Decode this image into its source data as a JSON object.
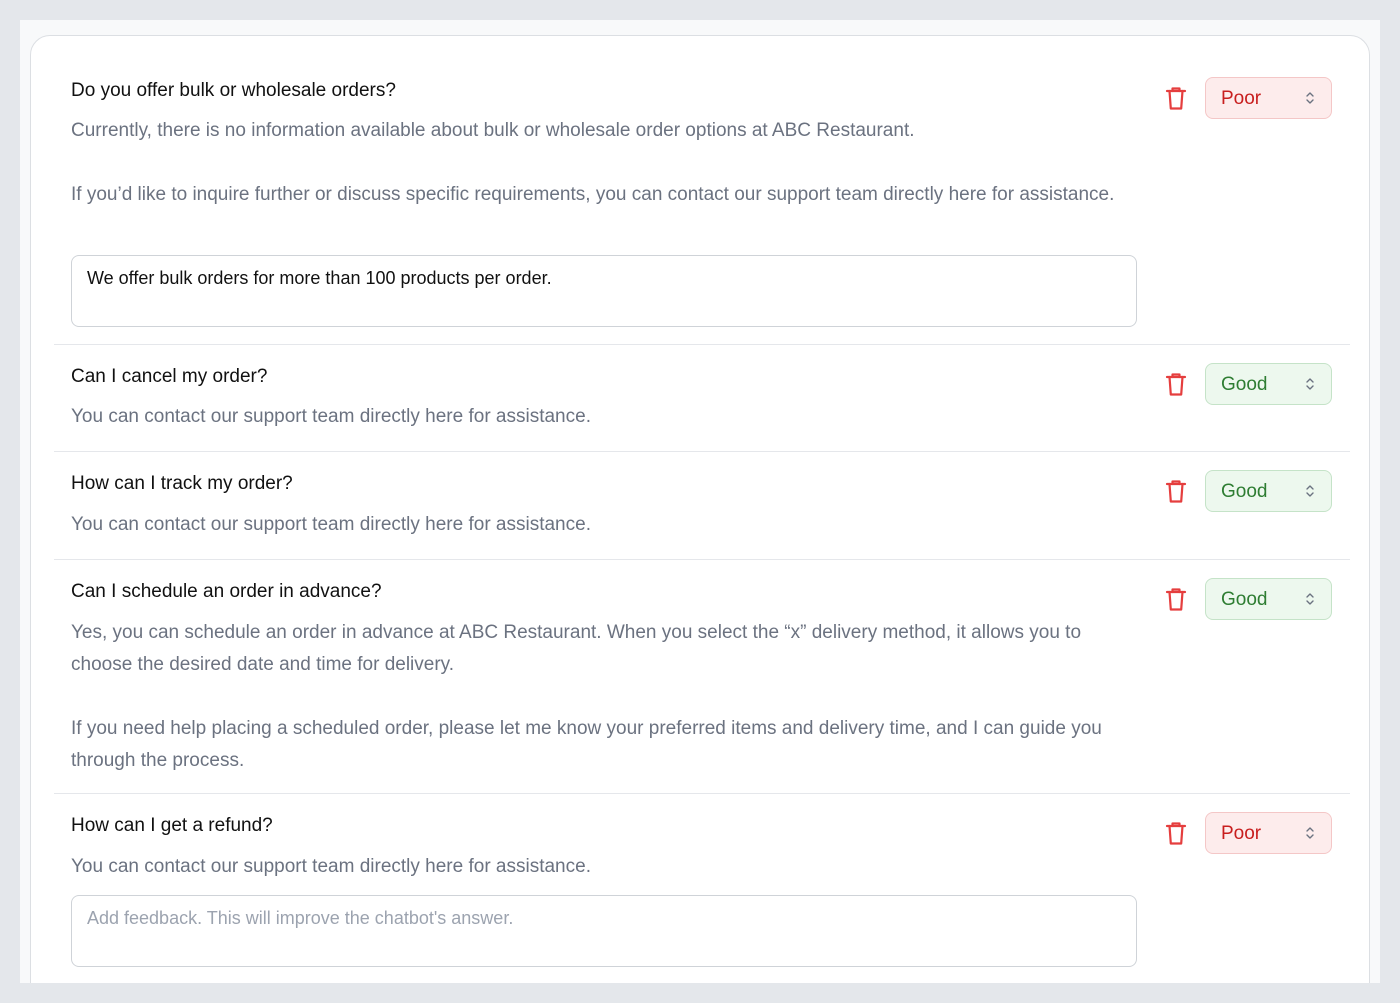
{
  "colors": {
    "poor_text": "#c81e1e",
    "poor_bg": "#fdecec",
    "good_text": "#2e7d32",
    "good_bg": "#edf8ee",
    "delete_icon": "#e53e3e"
  },
  "items": [
    {
      "question": "Do you offer bulk or wholesale orders?",
      "answer": [
        "Currently, there is no information available about bulk or wholesale order options at ABC Restaurant.",
        "If you’d like to inquire further or discuss specific requirements, you can contact our support team directly here for assistance."
      ],
      "rating": "Poor",
      "feedback_value": "We offer bulk orders for more than 100 products per order.",
      "delete_icon": "trash-icon",
      "select_icon": "chevron-up-down-icon"
    },
    {
      "question": "Can I cancel my order?",
      "answer": [
        "You can contact our support team directly here for assistance."
      ],
      "rating": "Good",
      "delete_icon": "trash-icon",
      "select_icon": "chevron-up-down-icon"
    },
    {
      "question": "How can I track my order?",
      "answer": [
        "You can contact our support team directly here for assistance."
      ],
      "rating": "Good",
      "delete_icon": "trash-icon",
      "select_icon": "chevron-up-down-icon"
    },
    {
      "question": "Can I schedule an order in advance?",
      "answer": [
        "Yes, you can schedule an order in advance at ABC Restaurant. When you select the “x” delivery method, it allows you to choose the desired date and time for delivery.",
        "If you need help placing a scheduled order, please let me know your preferred items and delivery time, and I can guide you through the process."
      ],
      "rating": "Good",
      "delete_icon": "trash-icon",
      "select_icon": "chevron-up-down-icon"
    },
    {
      "question": "How can I get a refund?",
      "answer": [
        "You can contact our support team directly here for assistance."
      ],
      "rating": "Poor",
      "feedback_value": "",
      "feedback_placeholder": "Add feedback. This will improve the chatbot's answer.",
      "delete_icon": "trash-icon",
      "select_icon": "chevron-up-down-icon"
    }
  ]
}
